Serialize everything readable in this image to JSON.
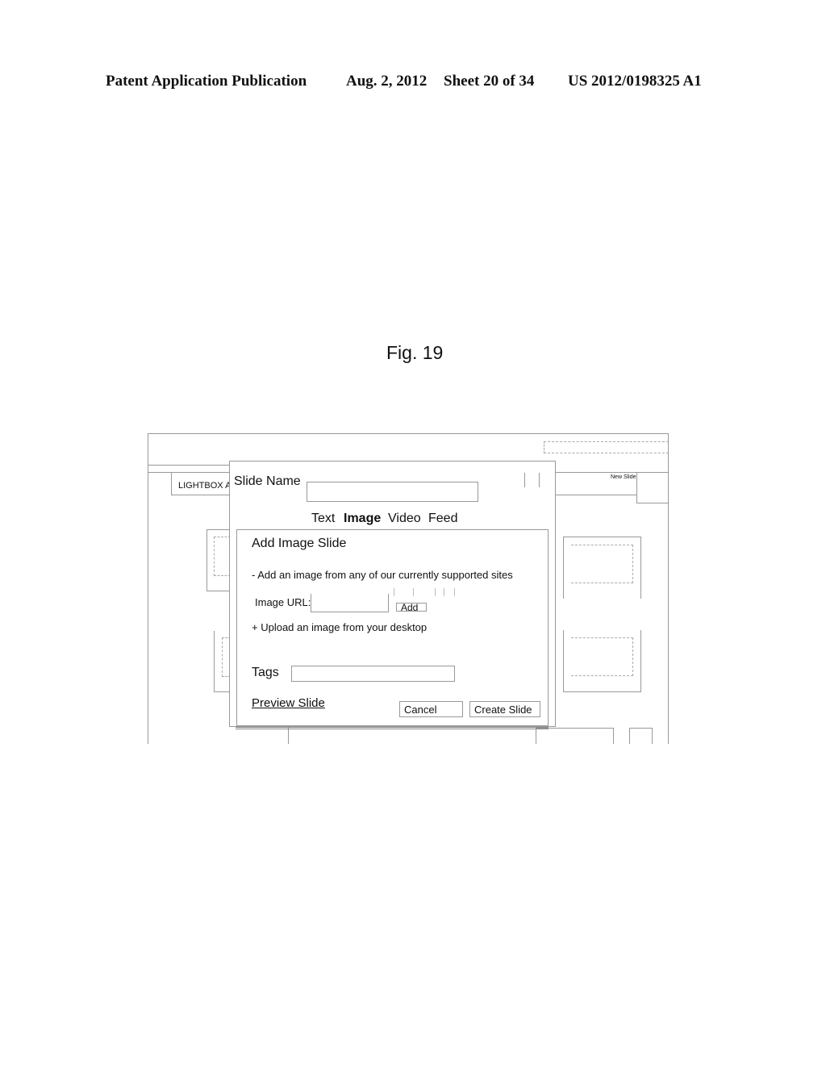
{
  "header": {
    "publication": "Patent Application Publication",
    "date": "Aug. 2, 2012",
    "sheet": "Sheet 20 of 34",
    "number": "US 2012/0198325 A1"
  },
  "figure_label": "Fig. 19",
  "background_app": {
    "lightbox_label": "LIGHTBOX A",
    "new_slide_label": "New Slide"
  },
  "dialog": {
    "slide_name_label": "Slide Name",
    "slide_name_value": "",
    "tabs": [
      {
        "label": "Text",
        "active": false
      },
      {
        "label": "Image",
        "active": true
      },
      {
        "label": "Video",
        "active": false
      },
      {
        "label": "Feed",
        "active": false
      }
    ],
    "panel": {
      "title": "Add Image Slide",
      "supported_sites_text": "-  Add an image from any of our currently supported sites",
      "image_url_label": "Image URL:",
      "image_url_value": "",
      "add_button": "Add",
      "upload_text": "+ Upload an image from your desktop",
      "tags_label": "Tags",
      "tags_value": "",
      "preview_link": "Preview Slide",
      "cancel_button": "Cancel",
      "create_button": "Create Slide"
    }
  }
}
